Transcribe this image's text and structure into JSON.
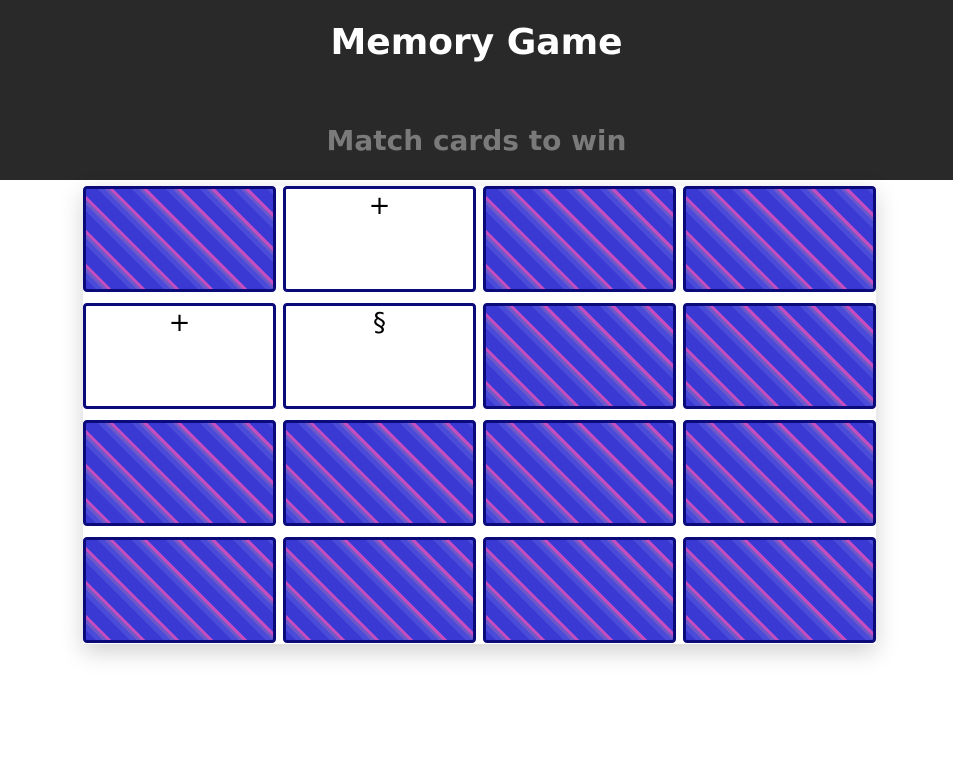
{
  "header": {
    "title": "Memory Game",
    "subtitle": "Match cards to win"
  },
  "colors": {
    "header_bg": "#292929",
    "card_border": "#0a0a7a",
    "card_back_primary": "#3a39d3",
    "card_back_stripe": "#c64dbf",
    "card_face": "#ffffff"
  },
  "board": {
    "cards": [
      {
        "state": "face-down",
        "symbol": ""
      },
      {
        "state": "face-up",
        "symbol": "+"
      },
      {
        "state": "face-down",
        "symbol": ""
      },
      {
        "state": "face-down",
        "symbol": ""
      },
      {
        "state": "face-up",
        "symbol": "+"
      },
      {
        "state": "face-up",
        "symbol": "§"
      },
      {
        "state": "face-down",
        "symbol": ""
      },
      {
        "state": "face-down",
        "symbol": ""
      },
      {
        "state": "face-down",
        "symbol": ""
      },
      {
        "state": "face-down",
        "symbol": ""
      },
      {
        "state": "face-down",
        "symbol": ""
      },
      {
        "state": "face-down",
        "symbol": ""
      },
      {
        "state": "face-down",
        "symbol": ""
      },
      {
        "state": "face-down",
        "symbol": ""
      },
      {
        "state": "face-down",
        "symbol": ""
      },
      {
        "state": "face-down",
        "symbol": ""
      }
    ]
  }
}
